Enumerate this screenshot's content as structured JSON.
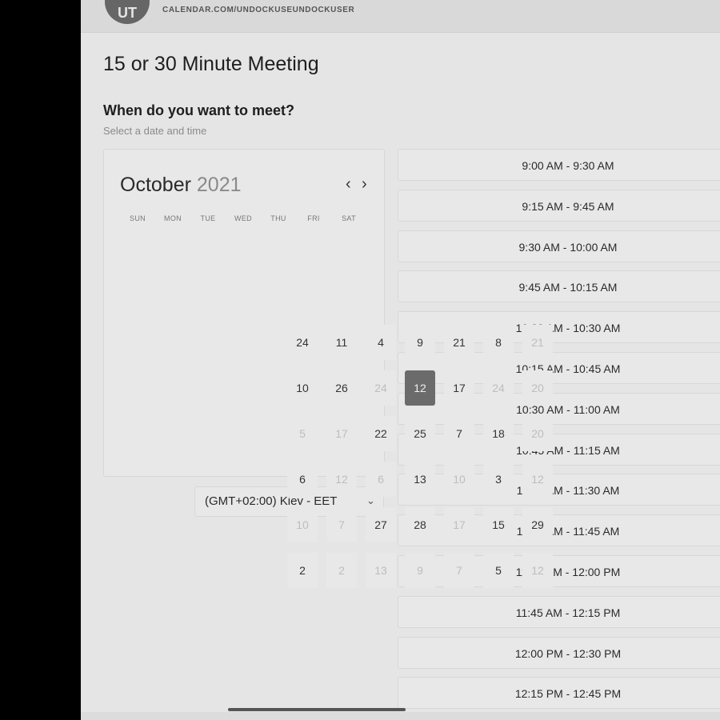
{
  "header": {
    "avatar_initials": "UT",
    "host_url": "CALENDAR.COM/UNDOCKUSEUNDOCKUSER"
  },
  "event": {
    "title": "15 or 30 Minute Meeting",
    "question": "When do you want to meet?",
    "subtitle": "Select a date and time"
  },
  "calendar": {
    "month": "October",
    "year": "2021",
    "prev_icon": "‹",
    "next_icon": "›",
    "weekdays": [
      "SUN",
      "MON",
      "TUE",
      "WED",
      "THU",
      "FRI",
      "SAT"
    ],
    "selected_day": "12",
    "rows": [
      [
        "24",
        "11",
        "4",
        "9",
        "21",
        "8",
        "21"
      ],
      [
        "10",
        "26",
        "24",
        "12",
        "17",
        "24",
        "20"
      ],
      [
        "5",
        "17",
        "22",
        "25",
        "7",
        "18",
        "20"
      ],
      [
        "6",
        "12",
        "6",
        "13",
        "10",
        "3",
        "12"
      ],
      [
        "10",
        "7",
        "27",
        "28",
        "17",
        "15",
        "29"
      ],
      [
        "2",
        "2",
        "13",
        "9",
        "7",
        "5",
        "12"
      ]
    ],
    "dimmed": [
      [
        false,
        false,
        false,
        false,
        false,
        false,
        true
      ],
      [
        false,
        false,
        true,
        false,
        false,
        true,
        true
      ],
      [
        true,
        true,
        false,
        false,
        false,
        false,
        true
      ],
      [
        false,
        true,
        true,
        false,
        true,
        false,
        true
      ],
      [
        true,
        true,
        false,
        false,
        true,
        false,
        false
      ],
      [
        false,
        true,
        true,
        true,
        true,
        false,
        true
      ]
    ]
  },
  "timezone": {
    "label": "(GMT+02:00) Kiev - EET",
    "chevron_icon": "⌄"
  },
  "time_slots": [
    "9:00 AM - 9:30 AM",
    "9:15 AM - 9:45 AM",
    "9:30 AM - 10:00 AM",
    "9:45 AM - 10:15 AM",
    "10:00 AM - 10:30 AM",
    "10:15 AM - 10:45 AM",
    "10:30 AM - 11:00 AM",
    "10:45 AM - 11:15 AM",
    "11:00 AM - 11:30 AM",
    "11:15 AM - 11:45 AM",
    "11:30 AM - 12:00 PM",
    "11:45 AM - 12:15 PM",
    "12:00 PM - 12:30 PM",
    "12:15 PM - 12:45 PM"
  ]
}
